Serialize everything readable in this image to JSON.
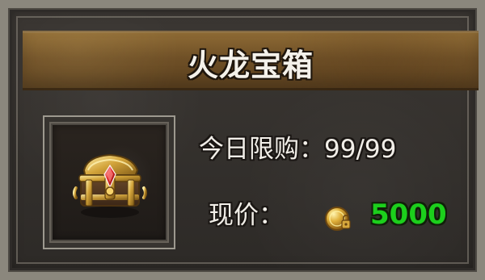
{
  "window": {
    "title": "火龙宝箱"
  },
  "item": {
    "icon": "treasure-chest-icon"
  },
  "purchase": {
    "limit_text": "今日限购：99/99",
    "price_label": "现价：",
    "currency_icon": "gold-coin-icon",
    "price_value": "5000"
  },
  "colors": {
    "title_bar": "#7a5a2c",
    "price_value": "#1ccf1c",
    "text": "#f1eee8"
  }
}
